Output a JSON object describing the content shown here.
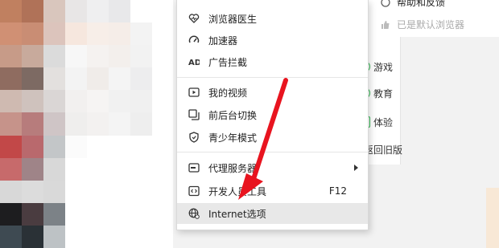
{
  "mosaic_colors": [
    [
      "#c08060",
      "#b07258",
      "#d9c6bd",
      "#e8e6e6",
      "#efeff0",
      "#e8e8ea",
      "#ffffff",
      "#ffffff"
    ],
    [
      "#d09074",
      "#c98d74",
      "#dcc4bc",
      "#f6e7de",
      "#f7eee8",
      "#f5ede8",
      "#f3f3f3",
      "#ffffff"
    ],
    [
      "#c79b88",
      "#c8aa9c",
      "#dbdbdb",
      "#f7f7f7",
      "#f5f2f0",
      "#f3efec",
      "#f2f2f2",
      "#ffffff"
    ],
    [
      "#8f6c60",
      "#7d6a63",
      "#e3e0de",
      "#f3f3f3",
      "#f0ece9",
      "#f4f4f4",
      "#ededee",
      "#ffffff"
    ],
    [
      "#cfbab1",
      "#cfc2bd",
      "#dad6d5",
      "#f2f0ef",
      "#f6f4f3",
      "#f1f1f1",
      "#f0f0f0",
      "#ffffff"
    ],
    [
      "#c6938a",
      "#b77c7c",
      "#cfc5c6",
      "#efeeed",
      "#f3f1f0",
      "#f4f4f4",
      "#eeeeee",
      "#ffffff"
    ],
    [
      "#c24848",
      "#b9696d",
      "#c3c6c8",
      "#fbfbfb",
      "#ffffff",
      "#ffffff",
      "#ffffff",
      "#ffffff"
    ],
    [
      "#c76a6b",
      "#9f8488",
      "#d8d8d8",
      "#ffffff",
      "#ffffff",
      "#ffffff",
      "#ffffff",
      "#ffffff"
    ],
    [
      "#d8d8d8",
      "#dcdcdc",
      "#d9d9d9",
      "#ffffff",
      "#ffffff",
      "#ffffff",
      "#ffffff",
      "#ffffff"
    ],
    [
      "#1d1d1f",
      "#4a3c40",
      "#7c8287",
      "#ffffff",
      "#ffffff",
      "#ffffff",
      "#ffffff",
      "#ffffff"
    ],
    [
      "#3e4a52",
      "#2a3136",
      "#bdc2c5",
      "#ffffff",
      "#ffffff",
      "#ffffff",
      "#ffffff",
      "#ffffff"
    ]
  ],
  "menu": {
    "items": [
      {
        "name": "browser-doctor",
        "label": "浏览器医生",
        "icon": "heart-pulse-icon"
      },
      {
        "name": "accelerator",
        "label": "加速器",
        "icon": "speedometer-icon"
      },
      {
        "name": "ad-blocker",
        "label": "广告拦截",
        "icon": "ad-block-icon"
      },
      {
        "name": "my-videos",
        "label": "我的视频",
        "icon": "play-video-icon"
      },
      {
        "name": "foreground-background-switch",
        "label": "前后台切换",
        "icon": "window-switch-icon"
      },
      {
        "name": "youth-mode",
        "label": "青少年模式",
        "icon": "shield-icon"
      },
      {
        "name": "proxy-server",
        "label": "代理服务器",
        "icon": "server-icon"
      },
      {
        "name": "developer-tools",
        "label": "开发人员工具",
        "icon": "code-icon",
        "shortcut": "F12"
      },
      {
        "name": "internet-options",
        "label": "Internet选项",
        "icon": "globe-gear-icon"
      }
    ]
  },
  "side": {
    "items": [
      "游戏",
      "教育",
      "体验",
      "返回旧版"
    ],
    "partial_top": "游戏"
  },
  "dropdown2": {
    "help": "帮助和反馈",
    "default_browser": "已是默认浏览器"
  },
  "colors": {
    "accent_green": "#2bb54d",
    "arrow_red": "#e8141f"
  }
}
